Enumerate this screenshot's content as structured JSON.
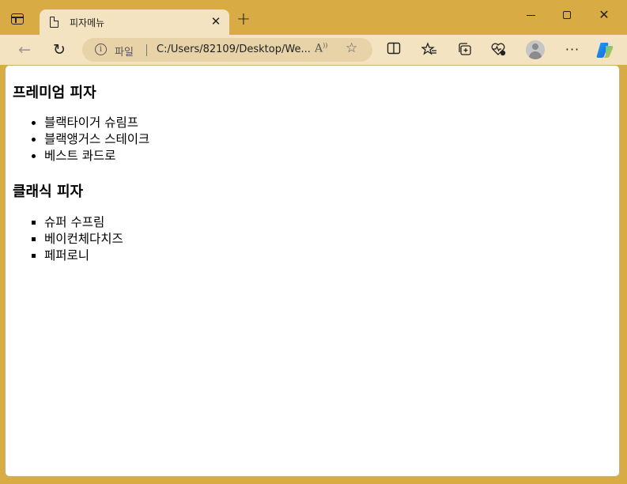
{
  "browser": {
    "tab": {
      "title": "피자메뉴",
      "close": "✕"
    },
    "new_tab": "+",
    "window_controls": {
      "close": "✕"
    },
    "address": {
      "scheme_label": "파일",
      "url": "C:/Users/82109/Desktop/We..."
    },
    "icons": {
      "back": "arrow-left-icon",
      "refresh": "refresh-icon",
      "info": "info-icon",
      "read_aloud": "read-aloud-icon",
      "favorite": "star-icon",
      "split": "split-screen-icon",
      "favorites": "favorites-icon",
      "collections": "collections-icon",
      "performance": "heart-pulse-icon",
      "profile": "profile-icon",
      "more": "more-icon",
      "copilot": "copilot-icon"
    },
    "colors": {
      "frame": "#d9ab45",
      "toolbar": "#f4e3c0",
      "address": "#e8d3a8"
    }
  },
  "page": {
    "sections": [
      {
        "heading": "프레미엄 피자",
        "items": [
          "블랙타이거 슈림프",
          "블랙앵거스 스테이크",
          "베스트 콰드로"
        ]
      },
      {
        "heading": "클래식 피자",
        "items": [
          "슈퍼 수프림",
          "베이컨체다치즈",
          "페퍼로니"
        ]
      }
    ]
  }
}
